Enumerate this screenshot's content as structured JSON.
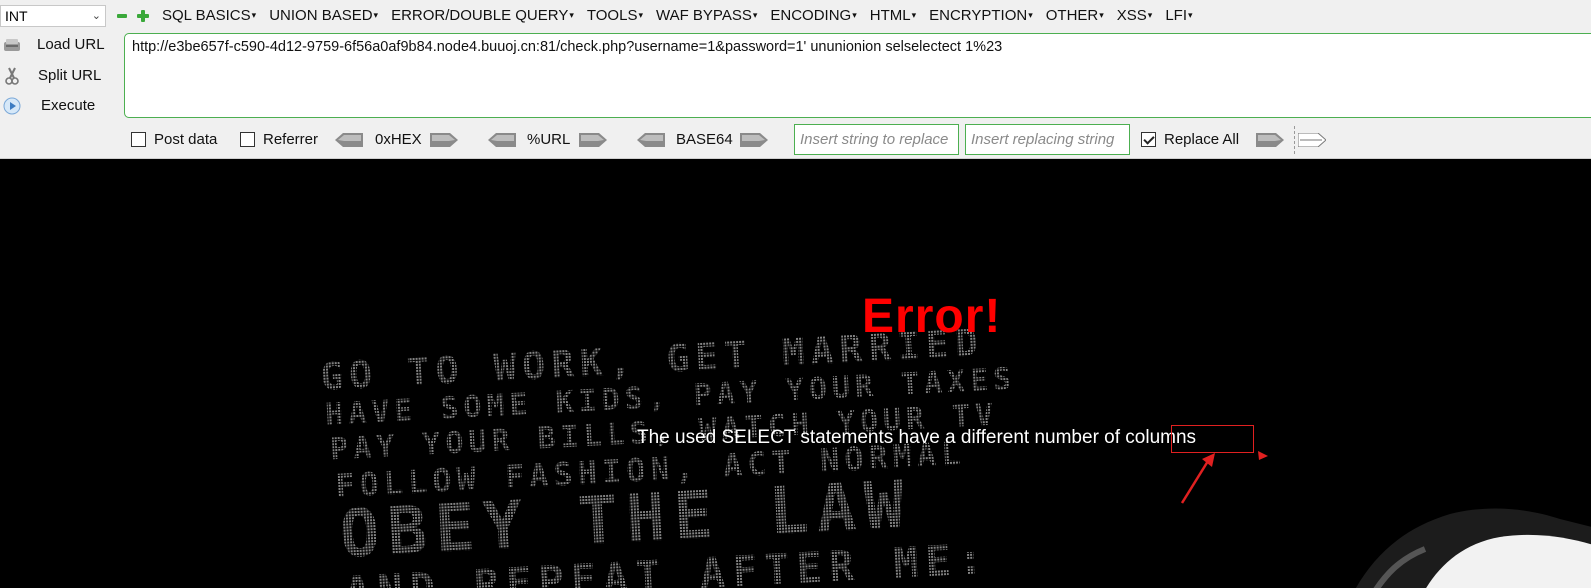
{
  "toolbar": {
    "type_select": "INT",
    "menus": [
      "SQL BASICS",
      "UNION BASED",
      "ERROR/DOUBLE QUERY",
      "TOOLS",
      "WAF BYPASS",
      "ENCODING",
      "HTML",
      "ENCRYPTION",
      "OTHER",
      "XSS",
      "LFI"
    ],
    "load_url": "Load URL",
    "split_url": "Split URL",
    "execute": "Execute",
    "url": "http://e3be657f-c590-4d12-9759-6f56a0af9b84.node4.buuoj.cn:81/check.php?username=1&password=1' ununionion selselectect 1%23",
    "post_data": "Post data",
    "referrer": "Referrer",
    "hex": "0xHEX",
    "url_enc": "%URL",
    "base64": "BASE64",
    "insert_string_placeholder": "Insert string to replace",
    "insert_replacing_placeholder": "Insert replacing string",
    "replace_all": "Replace All",
    "post_data_checked": false,
    "referrer_checked": false,
    "replace_all_checked": true
  },
  "page": {
    "error_title": "Error!",
    "message_prefix": "The used SELECT statements have a different number of ",
    "message_highlight": "columns",
    "background_lines": [
      "GO TO WORK, GET MARRIED",
      "HAVE SOME KIDS, PAY YOUR TAXES",
      "PAY YOUR BILLS, WATCH YOUR TV",
      "FOLLOW FASHION, ACT NORMAL",
      "OBEY THE LAW",
      "AND REPEAT AFTER ME:"
    ]
  },
  "colors": {
    "accent_green": "#4caf50",
    "error_red": "#ff0000",
    "annotation_red": "#e02020"
  }
}
